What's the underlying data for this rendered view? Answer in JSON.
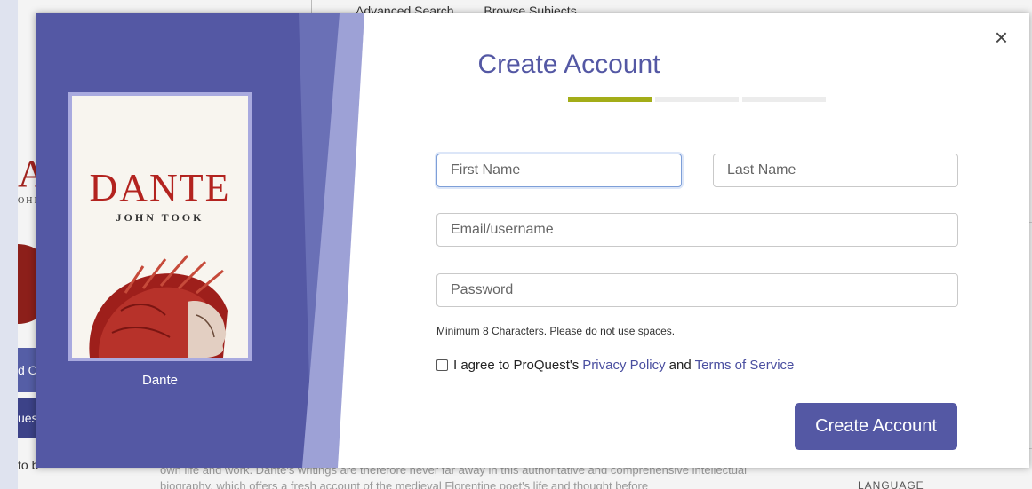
{
  "background": {
    "nav": [
      "Advanced Search",
      "Browse Subjects"
    ],
    "cover_peek_title": "A",
    "cover_peek_sub": "OHN",
    "side_button_1": "d O",
    "side_button_2": "ues",
    "side_link": "to b",
    "body_text": "own life and work. Dante's writings are therefore never far away in this authoritative and comprehensive intellectual biography, which offers a fresh account of the medieval Florentine poet's life and thought before",
    "language_label": "LANGUAGE"
  },
  "book": {
    "cover_title": "DANTE",
    "cover_author": "JOHN TOOK",
    "caption": "Dante"
  },
  "modal": {
    "close_glyph": "×",
    "title": "Create Account",
    "steps": {
      "total": 3,
      "current": 1
    },
    "fields": {
      "first_name_placeholder": "First Name",
      "last_name_placeholder": "Last Name",
      "email_placeholder": "Email/username",
      "password_placeholder": "Password"
    },
    "password_hint": "Minimum 8 Characters. Please do not use spaces.",
    "agree": {
      "prefix": "I agree to ProQuest's",
      "privacy_link": "Privacy Policy",
      "and": "and",
      "terms_link": "Terms of Service",
      "checked": false
    },
    "submit_label": "Create Account"
  },
  "colors": {
    "brand": "#5458a4",
    "progress_active": "#a3ad18",
    "progress_inactive": "#ececec"
  }
}
